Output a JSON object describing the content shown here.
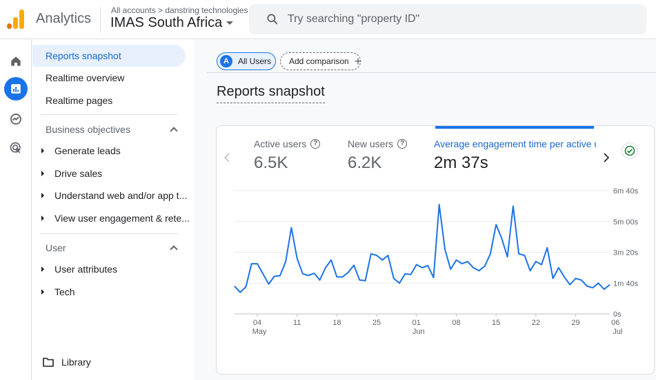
{
  "header": {
    "app_name": "Analytics",
    "account_crumb": "All accounts > danstring technologies",
    "property_name": "IMAS South Africa",
    "search_placeholder": "Try searching \"property ID\""
  },
  "sidebar": {
    "items": [
      {
        "label": "Reports snapshot",
        "active": true
      },
      {
        "label": "Realtime overview"
      },
      {
        "label": "Realtime pages"
      }
    ],
    "sections": [
      {
        "title": "Business objectives",
        "children": [
          "Generate leads",
          "Drive sales",
          "Understand web and/or app t...",
          "View user engagement & rete..."
        ]
      },
      {
        "title": "User",
        "children": [
          "User attributes",
          "Tech"
        ]
      }
    ],
    "library_label": "Library"
  },
  "main": {
    "comparison_chip": {
      "badge": "A",
      "label": "All Users"
    },
    "add_comparison_label": "Add comparison",
    "page_title": "Reports snapshot",
    "metrics": [
      {
        "label": "Active users",
        "value": "6.5K"
      },
      {
        "label": "New users",
        "value": "6.2K"
      },
      {
        "label": "Average engagement time per active user",
        "value": "2m 37s",
        "active": true
      }
    ]
  },
  "colors": {
    "accent": "#1a73e8",
    "series": "#1a73e8",
    "check": "#188038"
  },
  "chart_data": {
    "type": "line",
    "ylabel": "",
    "y_ticks": [
      "0s",
      "1m 40s",
      "3m 20s",
      "5m 00s",
      "6m 40s"
    ],
    "ylim": [
      0,
      400
    ],
    "x_tick_labels": [
      {
        "day": "04",
        "month": "May"
      },
      {
        "day": "11"
      },
      {
        "day": "18"
      },
      {
        "day": "25"
      },
      {
        "day": "01",
        "month": "Jun"
      },
      {
        "day": "08"
      },
      {
        "day": "15"
      },
      {
        "day": "22"
      },
      {
        "day": "29"
      },
      {
        "day": "06",
        "month": "Jul"
      }
    ],
    "series": [
      {
        "values": [
          90,
          70,
          88,
          163,
          163,
          130,
          97,
          122,
          124,
          170,
          280,
          180,
          130,
          125,
          132,
          110,
          150,
          175,
          120,
          120,
          135,
          158,
          110,
          108,
          195,
          190,
          175,
          190,
          115,
          100,
          130,
          128,
          160,
          150,
          157,
          118,
          355,
          210,
          145,
          175,
          163,
          170,
          150,
          140,
          155,
          195,
          290,
          245,
          185,
          350,
          195,
          190,
          140,
          170,
          160,
          215,
          115,
          150,
          120,
          95,
          115,
          110,
          90,
          85,
          100,
          80,
          95
        ]
      }
    ]
  }
}
